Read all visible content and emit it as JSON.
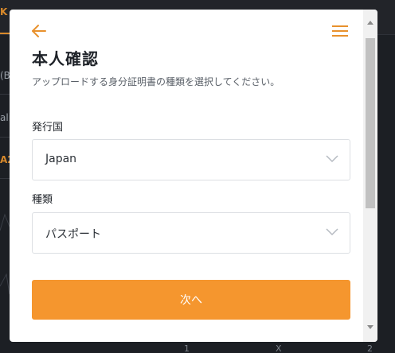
{
  "background": {
    "tab_fragment": "K",
    "row_fragments": [
      "(B",
      "ali",
      "A2"
    ],
    "axis_labels": [
      "1",
      "X",
      "2"
    ]
  },
  "modal": {
    "title": "本人確認",
    "subtitle": "アップロードする身分証明書の種類を選択してください。",
    "country_field": {
      "label": "発行国",
      "value": "Japan"
    },
    "type_field": {
      "label": "種類",
      "value": "パスポート"
    },
    "next_button_label": "次へ"
  },
  "icons": {
    "back": "arrow-left-icon",
    "menu": "hamburger-menu-icon",
    "dropdown": "chevron-down-icon"
  },
  "colors": {
    "accent": "#f5962e",
    "accent_icon": "#e8912d",
    "modal_bg": "#ffffff",
    "page_bg": "#1c1f24",
    "title_text": "#1f2329",
    "muted_text": "#5a6068",
    "border": "#dcdfe3"
  }
}
